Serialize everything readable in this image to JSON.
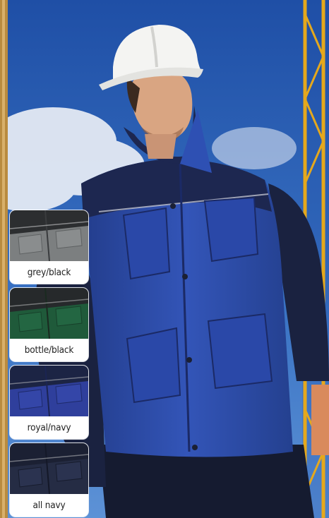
{
  "colors": {
    "sky": "#2e63b5",
    "jacket_royal": "#2f4fb0",
    "jacket_navy": "#1a2240",
    "helmet": "#f4f4f2",
    "crane": "#e5a81c"
  },
  "colour_options": [
    {
      "label": "grey/black",
      "body": "#7c7f80",
      "yoke": "#2c2e30"
    },
    {
      "label": "bottle/black",
      "body": "#1f5a3a",
      "yoke": "#26292b"
    },
    {
      "label": "royal/navy",
      "body": "#2f3f9c",
      "yoke": "#1c2444"
    },
    {
      "label": "all navy",
      "body": "#252c44",
      "yoke": "#1b2033"
    }
  ]
}
